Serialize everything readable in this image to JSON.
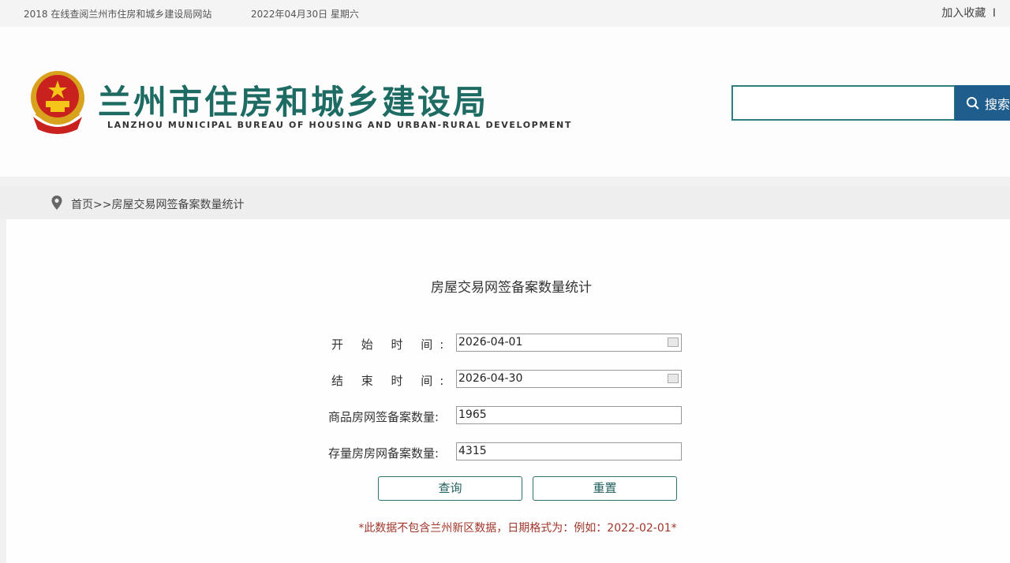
{
  "topbar": {
    "site_notice": "2018 在线查阅兰州市住房和城乡建设局网站",
    "date_text": "2022年04月30日 星期六",
    "bookmark_label": "加入收藏",
    "extra_label": "I"
  },
  "header": {
    "title": "兰州市住房和城乡建设局",
    "subtitle": "LANZHOU MUNICIPAL BUREAU OF HOUSING AND URBAN-RURAL DEVELOPMENT",
    "search_placeholder": "",
    "search_label": "搜索"
  },
  "breadcrumb": {
    "home": "首页",
    "separator": ">>",
    "current": "房屋交易网签备案数量统计"
  },
  "form": {
    "title": "房屋交易网签备案数量统计",
    "start_label": "开 始 时 间:",
    "start_value": "2026-04-01",
    "end_label": "结 束 时 间:",
    "end_value": "2026-04-30",
    "new_house_label": "商品房网签备案数量:",
    "new_house_value": "1965",
    "existing_house_label": "存量房房网备案数量:",
    "existing_house_value": "4315",
    "query_label": "查询",
    "reset_label": "重置",
    "note": "*此数据不包含兰州新区数据，日期格式为：例如：2022-02-01*"
  },
  "colors": {
    "brand_green": "#1d6b63",
    "search_blue": "#1f5d8c",
    "note_red": "#a0352a"
  }
}
